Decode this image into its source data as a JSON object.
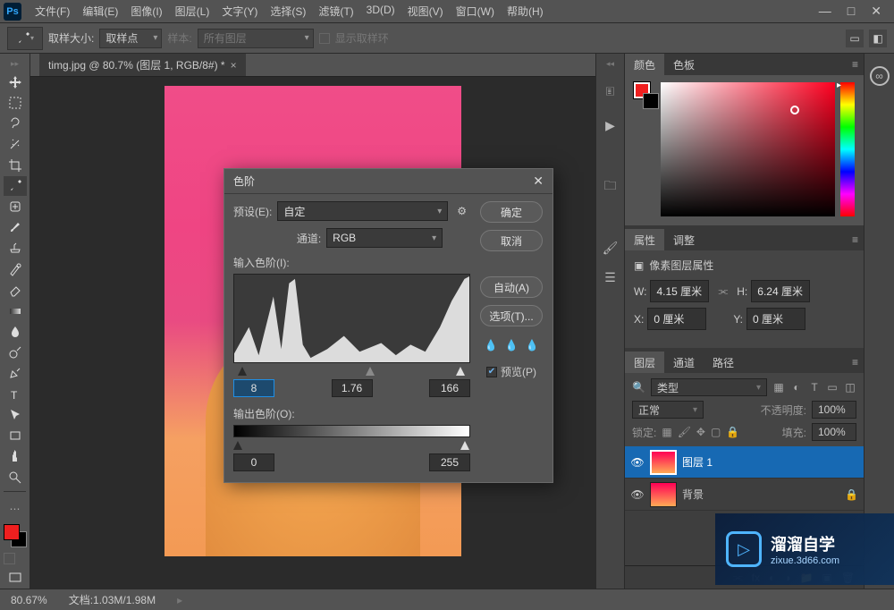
{
  "menubar": {
    "items": [
      "文件(F)",
      "编辑(E)",
      "图像(I)",
      "图层(L)",
      "文字(Y)",
      "选择(S)",
      "滤镜(T)",
      "3D(D)",
      "视图(V)",
      "窗口(W)",
      "帮助(H)"
    ]
  },
  "options": {
    "sample_size_label": "取样大小:",
    "sample_size_value": "取样点",
    "sample_label": "样本:",
    "sample_value": "所有图层",
    "show_ring_label": "显示取样环"
  },
  "doc_tab": "timg.jpg @ 80.7% (图层 1, RGB/8#) *",
  "status": {
    "zoom": "80.67%",
    "doc": "文档:1.03M/1.98M"
  },
  "panels": {
    "color_tabs": [
      "颜色",
      "色板"
    ],
    "props_tabs": [
      "属性",
      "调整"
    ],
    "props_title": "像素图层属性",
    "w_label": "W:",
    "w_value": "4.15 厘米",
    "h_label": "H:",
    "h_value": "6.24 厘米",
    "x_label": "X:",
    "x_value": "0 厘米",
    "y_label": "Y:",
    "y_value": "0 厘米",
    "layers_tabs": [
      "图层",
      "通道",
      "路径"
    ],
    "kind_label": "类型",
    "blend_mode": "正常",
    "opacity_label": "不透明度:",
    "opacity_value": "100%",
    "lock_label": "锁定:",
    "fill_label": "填充:",
    "fill_value": "100%",
    "layer_items": [
      {
        "name": "图层 1",
        "selected": true
      },
      {
        "name": "背景",
        "selected": false
      }
    ]
  },
  "dialog": {
    "title": "色阶",
    "preset_label": "预设(E):",
    "preset_value": "自定",
    "channel_label": "通道:",
    "channel_value": "RGB",
    "input_label": "输入色阶(I):",
    "input_black": "8",
    "input_gamma": "1.76",
    "input_white": "166",
    "output_label": "输出色阶(O):",
    "output_black": "0",
    "output_white": "255",
    "ok": "确定",
    "cancel": "取消",
    "auto": "自动(A)",
    "options": "选项(T)...",
    "preview": "预览(P)"
  },
  "watermark": {
    "title": "溜溜自学",
    "url": "zixue.3d66.com"
  }
}
